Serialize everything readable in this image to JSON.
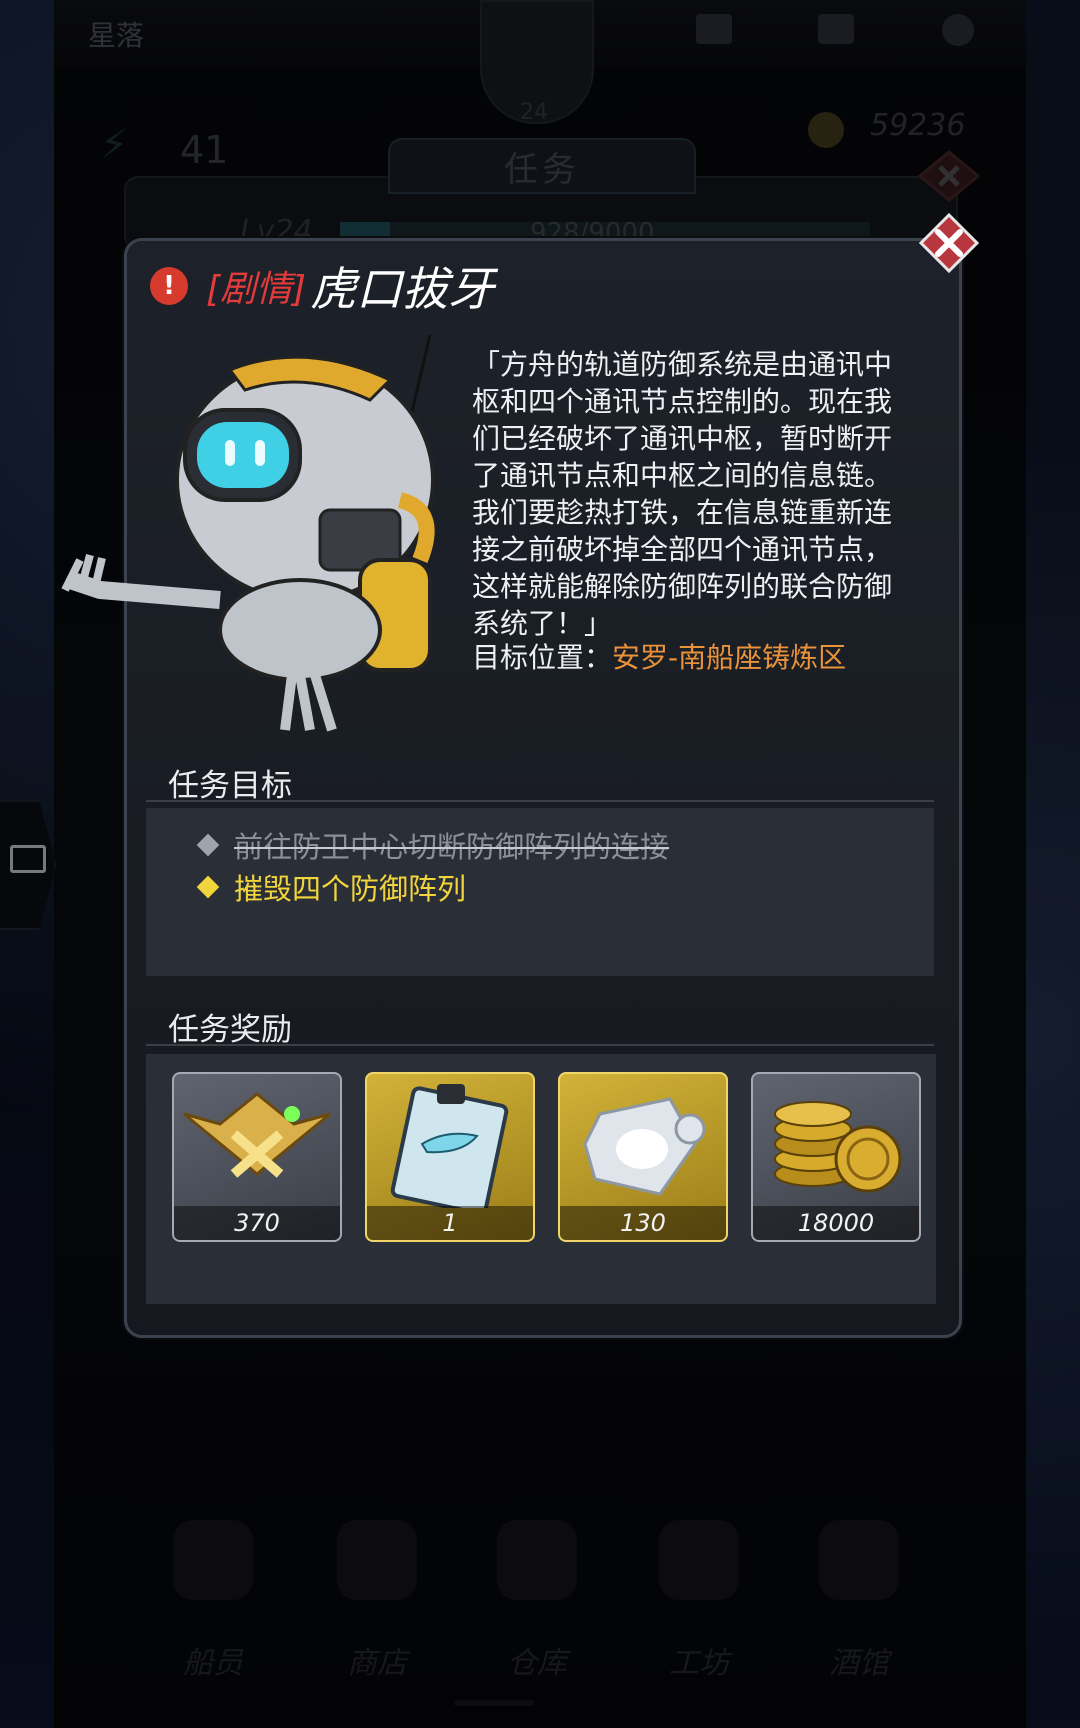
{
  "hud": {
    "player_name": "星落",
    "player_level": "24",
    "energy": "41",
    "gold": "59236"
  },
  "background": {
    "task_tab": "任务",
    "level_label": "Lv24",
    "xp_text": "928/9000"
  },
  "bottom_nav": [
    {
      "label": "船员"
    },
    {
      "label": "商店"
    },
    {
      "label": "仓库"
    },
    {
      "label": "工坊"
    },
    {
      "label": "酒馆"
    }
  ],
  "dialog": {
    "tag": "[剧情]",
    "title": "虎口拔牙",
    "story_lines": [
      "「方舟的轨道防御系统是由通讯中",
      "枢和四个通讯节点控制的。现在我",
      "们已经破坏了通讯中枢，暂时断开",
      "了通讯节点和中枢之间的信息链。",
      "我们要趁热打铁，在信息链重新连",
      "接之前破坏掉全部四个通讯节点，",
      "这样就能解除防御阵列的联合防御",
      "系统了！」"
    ],
    "target_label": "目标位置：",
    "target_location": "安罗-南船座铸炼区",
    "objectives_heading": "任务目标",
    "objectives": [
      {
        "text": "前往防卫中心切断防御阵列的连接",
        "status": "done"
      },
      {
        "text": "摧毁四个防御阵列",
        "status": "active"
      }
    ],
    "rewards_heading": "任务奖励",
    "rewards": [
      {
        "icon": "rank-badge-icon",
        "qty": "370",
        "frame": "gray"
      },
      {
        "icon": "blueprint-card-icon",
        "qty": "1",
        "frame": "gold"
      },
      {
        "icon": "puzzle-fragment-icon",
        "qty": "130",
        "frame": "gold"
      },
      {
        "icon": "gold-coins-icon",
        "qty": "18000",
        "frame": "gray"
      }
    ]
  },
  "colors": {
    "tag_red": "#e13b3b",
    "location_orange": "#e9923a",
    "active_yellow": "#f2d53c",
    "close_red": "#b8373e"
  }
}
